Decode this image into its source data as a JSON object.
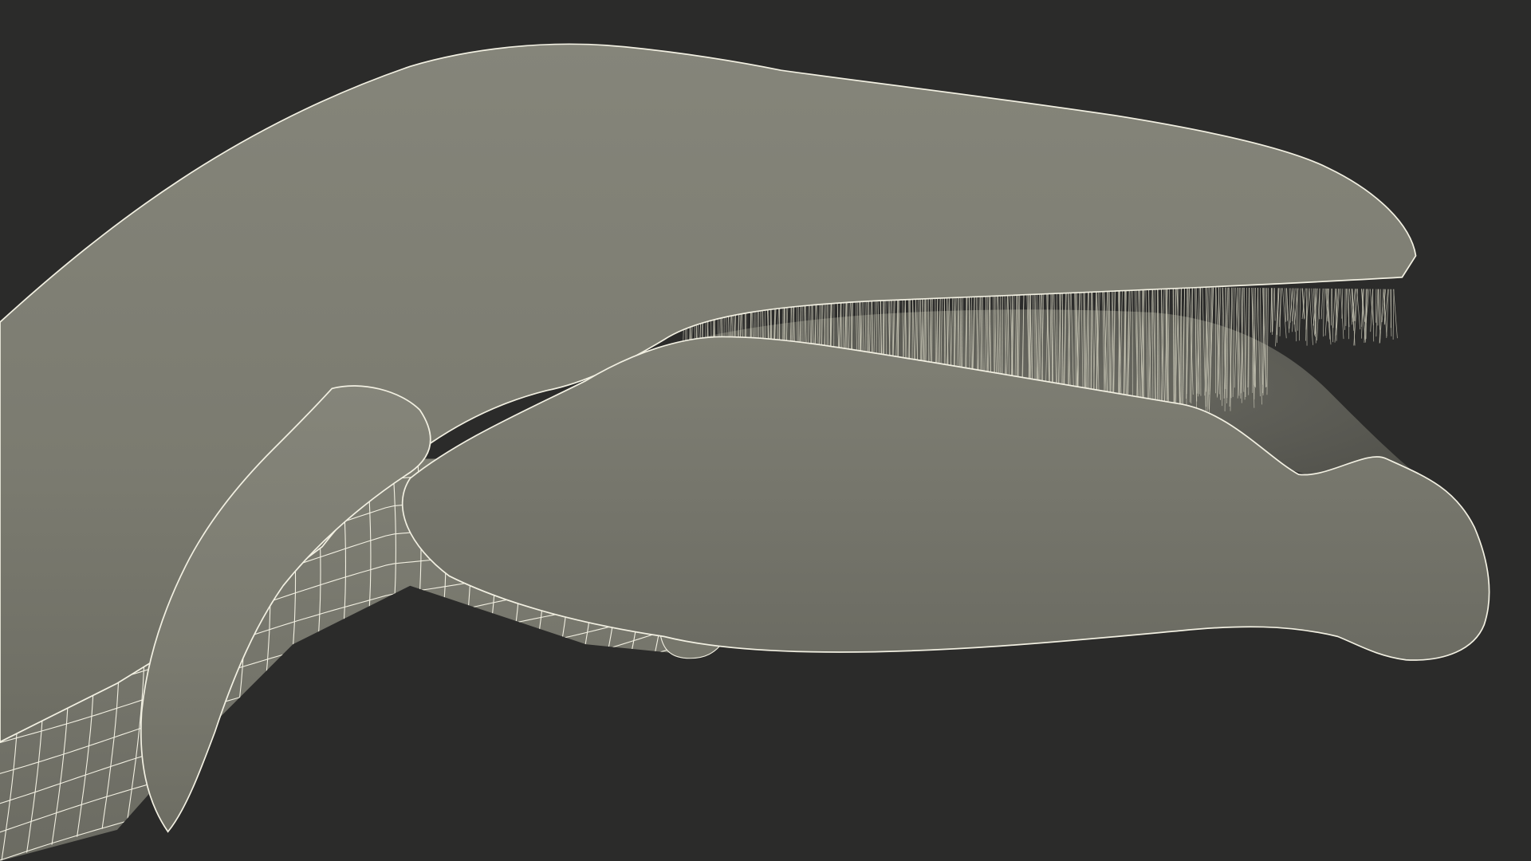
{
  "scene": {
    "subject": "baleen-whale-head-wireframe",
    "colors": {
      "background": "#2b2b2a",
      "body_fill": "#7b7b70",
      "body_shadow": "#5f5f57",
      "mouth_interior": "#55554e",
      "wire": "#f2f0e2",
      "baleen": "#d8d6c4"
    },
    "visible_text": []
  }
}
